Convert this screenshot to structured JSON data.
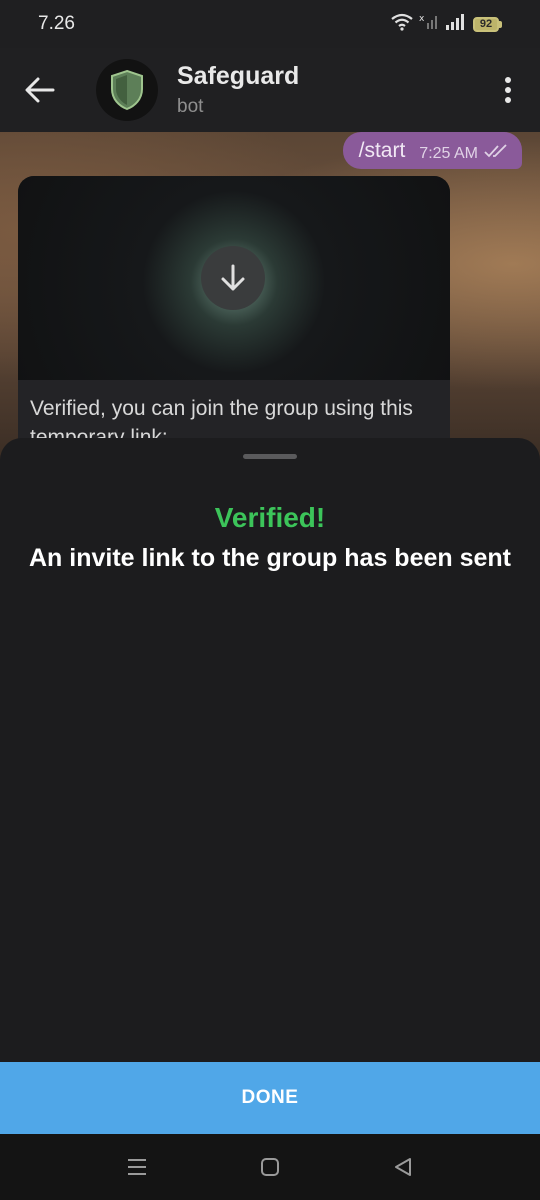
{
  "status_bar": {
    "time": "7.26",
    "battery_level": "92",
    "icons": [
      "wifi-icon",
      "no-signal-icon",
      "signal-icon",
      "battery-icon"
    ]
  },
  "header": {
    "title": "Safeguard",
    "subtitle": "bot",
    "icons": [
      "back-arrow-icon",
      "shield-icon",
      "more-vert-icon"
    ]
  },
  "chat": {
    "outgoing": {
      "text": "/start",
      "time": "7:25 AM",
      "status_icon": "double-check-icon"
    },
    "incoming": {
      "media_icon": "download-icon",
      "caption": "Verified, you can join the group using this temporary link:"
    }
  },
  "sheet": {
    "title": "Verified!",
    "message": "An invite link to the group has been sent",
    "done_label": "DONE"
  },
  "nav_bar": {
    "icons": [
      "recents-icon",
      "home-icon",
      "back-icon"
    ]
  },
  "colors": {
    "accent_green": "#3cc45a",
    "done_button": "#50a7e8",
    "outgoing_bubble": "#8a5a9a",
    "sheet_background": "#1c1c1e"
  }
}
